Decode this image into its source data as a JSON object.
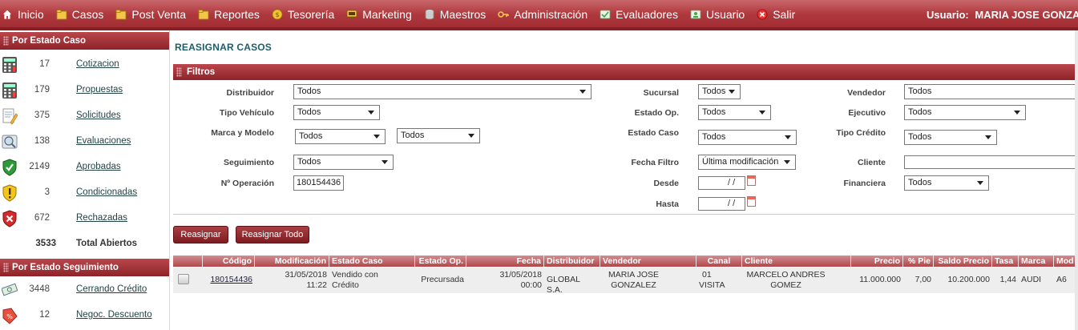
{
  "menu": {
    "items": [
      {
        "label": "Inicio",
        "icon": "home-icon"
      },
      {
        "label": "Casos",
        "icon": "folder-icon"
      },
      {
        "label": "Post Venta",
        "icon": "folder-icon"
      },
      {
        "label": "Reportes",
        "icon": "folder-icon"
      },
      {
        "label": "Tesorería",
        "icon": "coin-icon"
      },
      {
        "label": "Marketing",
        "icon": "monitor-icon"
      },
      {
        "label": "Maestros",
        "icon": "database-icon"
      },
      {
        "label": "Administración",
        "icon": "key-icon"
      },
      {
        "label": "Evaluadores",
        "icon": "evaluator-icon"
      },
      {
        "label": "Usuario",
        "icon": "user-icon"
      },
      {
        "label": "Salir",
        "icon": "exit-icon"
      }
    ],
    "user_label": "Usuario:",
    "user_name": "MARIA JOSE GONZAL"
  },
  "sidebar": {
    "estado_caso_title": "Por Estado Caso",
    "estado_caso": [
      {
        "count": "17",
        "label": "Cotizacion",
        "icon": "calculator-icon"
      },
      {
        "count": "179",
        "label": "Propuestas",
        "icon": "calculator-icon"
      },
      {
        "count": "375",
        "label": "Solicitudes",
        "icon": "document-pencil-icon"
      },
      {
        "count": "138",
        "label": "Evaluaciones",
        "icon": "magnifier-icon"
      },
      {
        "count": "2149",
        "label": "Aprobadas",
        "icon": "shield-check-icon"
      },
      {
        "count": "3",
        "label": "Condicionadas",
        "icon": "shield-warning-icon"
      },
      {
        "count": "672",
        "label": "Rechazadas",
        "icon": "shield-x-icon"
      }
    ],
    "total_count": "3533",
    "total_label": "Total Abiertos",
    "seguimiento_title": "Por Estado Seguimiento",
    "seguimiento": [
      {
        "count": "3448",
        "label": "Cerrando Crédito",
        "icon": "money-icon"
      },
      {
        "count": "12",
        "label": "Negoc. Descuento",
        "icon": "discount-tag-icon"
      }
    ]
  },
  "page": {
    "title": "REASIGNAR CASOS",
    "filters_title": "Filtros"
  },
  "filters": {
    "distribuidor_label": "Distribuidor",
    "distribuidor": "Todos",
    "tipo_vehiculo_label": "Tipo Vehículo",
    "tipo_vehiculo": "Todos",
    "marca_modelo_label": "Marca y Modelo",
    "marca": "Todos",
    "modelo": "Todos",
    "seguimiento_label": "Seguimiento",
    "seguimiento": "Todos",
    "operacion_label": "Nº Operación",
    "operacion": "180154436",
    "sucursal_label": "Sucursal",
    "sucursal": "Todos",
    "estado_op_label": "Estado Op.",
    "estado_op": "Todos",
    "estado_caso_label": "Estado Caso",
    "estado_caso": "Todos",
    "fecha_filtro_label": "Fecha Filtro",
    "fecha_filtro": "Última modificación",
    "desde_label": "Desde",
    "desde": "/ /",
    "hasta_label": "Hasta",
    "hasta": "/ /",
    "vendedor_label": "Vendedor",
    "vendedor": "Todos",
    "ejecutivo_label": "Ejecutivo",
    "ejecutivo": "Todos",
    "tipo_credito_label": "Tipo Crédito",
    "tipo_credito": "Todos",
    "cliente_label": "Cliente",
    "cliente": "",
    "financiera_label": "Financiera",
    "financiera": "Todos"
  },
  "buttons": {
    "reasignar": "Reasignar",
    "reasignar_todo": "Reasignar Todo"
  },
  "table": {
    "headers": [
      "Código",
      "Modificación",
      "Estado Caso",
      "Estado Op.",
      "Fecha",
      "Distribuidor",
      "Vendedor",
      "Canal",
      "Cliente",
      "Precio",
      "% Pie",
      "Saldo Precio",
      "Tasa",
      "Marca",
      "Mod"
    ],
    "rows": [
      {
        "codigo": "180154436",
        "modificacion_fecha": "31/05/2018",
        "modificacion_hora": "11:22",
        "estado_caso_1": "Vendido con",
        "estado_caso_2": "Crédito",
        "estado_op": "Precursada",
        "fecha_1": "31/05/2018",
        "fecha_2": "00:00",
        "distribuidor": "GLOBAL S.A.",
        "vendedor_1": "MARIA JOSE",
        "vendedor_2": "GONZALEZ",
        "canal_1": "01",
        "canal_2": "VISITA",
        "cliente_1": "MARCELO ANDRES",
        "cliente_2": "GOMEZ",
        "precio": "11.000.000",
        "pie": "7,00",
        "saldo": "10.200.000",
        "tasa": "1,44",
        "marca": "AUDI",
        "modelo": "A6"
      }
    ]
  },
  "colors": {
    "brand": "#9e2a30",
    "title": "#1c5d6b"
  }
}
